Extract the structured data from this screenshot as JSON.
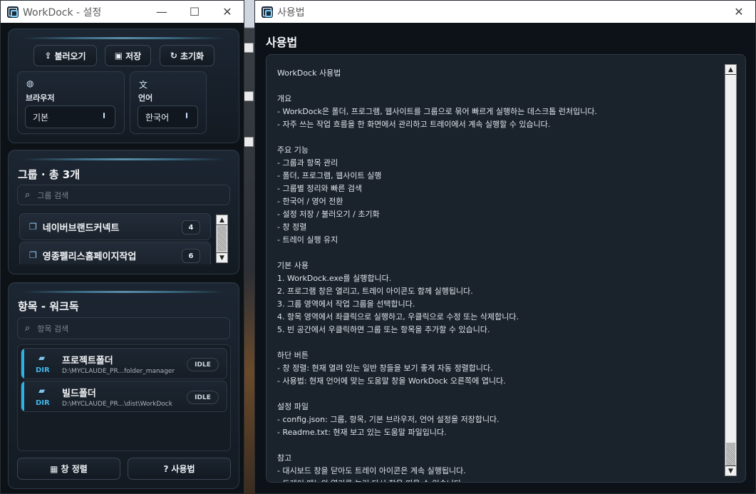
{
  "settings_window": {
    "title": "WorkDock - 설정",
    "controls": {
      "minimize": "—",
      "maximize": "☐",
      "close": "✕"
    },
    "toolbar": {
      "load_label": "불러오기",
      "save_label": "저장",
      "reset_label": "초기화"
    },
    "browser": {
      "label": "브라우저",
      "value": "기본"
    },
    "language": {
      "label": "언어",
      "value": "한국어"
    },
    "groups": {
      "title": "그룹 · 총 3개",
      "search_placeholder": "그룹 검색",
      "items": [
        {
          "name": "네이버브랜드커넥트",
          "count": "4"
        },
        {
          "name": "영종펠리스홈페이지작업",
          "count": "6"
        }
      ]
    },
    "items": {
      "title": "항목 - 워크독",
      "search_placeholder": "항목 검색",
      "list": [
        {
          "name": "프로젝트폴더",
          "type": "DIR",
          "path": "D:\\MYCLAUDE_PR...folder_manager",
          "status": "IDLE"
        },
        {
          "name": "빌드폴더",
          "type": "DIR",
          "path": "D:\\MYCLAUDE_PR...\\dist\\WorkDock",
          "status": "IDLE"
        }
      ]
    },
    "footer": {
      "arrange_label": "창 정렬",
      "help_label": "사용법"
    }
  },
  "help_window": {
    "title": "사용법",
    "controls": {
      "close": "✕"
    },
    "heading": "사용법",
    "lines": [
      "WorkDock 사용법",
      "",
      "개요",
      "- WorkDock은 폴더, 프로그램, 웹사이트를 그룹으로 묶어 빠르게 실행하는 데스크톱 런처입니다.",
      "- 자주 쓰는 작업 흐름을 한 화면에서 관리하고 트레이에서 계속 실행할 수 있습니다.",
      "",
      "주요 기능",
      "- 그룹과 항목 관리",
      "- 폴더, 프로그램, 웹사이트 실행",
      "- 그룹별 정리와 빠른 검색",
      "- 한국어 / 영어 전환",
      "- 설정 저장 / 불러오기 / 초기화",
      "- 창 정렬",
      "- 트레이 실행 유지",
      "",
      "기본 사용",
      "1. WorkDock.exe를 실행합니다.",
      "2. 프로그램 창은 열리고, 트레이 아이콘도 함께 실행됩니다.",
      "3. 그룹 영역에서 작업 그룹을 선택합니다.",
      "4. 항목 영역에서 좌클릭으로 실행하고, 우클릭으로 수정 또는 삭제합니다.",
      "5. 빈 공간에서 우클릭하면 그룹 또는 항목을 추가할 수 있습니다.",
      "",
      "하단 버튼",
      "- 창 정렬: 현재 열려 있는 일반 창들을 보기 좋게 자동 정렬합니다.",
      "- 사용법: 현재 언어에 맞는 도움말 창을 WorkDock 오른쪽에 엽니다.",
      "",
      "설정 파일",
      "- config.json: 그룹, 항목, 기본 브라우저, 언어 설정을 저장합니다.",
      "- Readme.txt: 현재 보고 있는 도움말 파일입니다.",
      "",
      "참고",
      "- 대시보드 창을 닫아도 트레이 아이콘은 계속 실행됩니다.",
      "- 트레이 메뉴의 열기를 눌러 다시 창을 띄울 수 있습니다."
    ]
  },
  "colors": {
    "accent": "#2bb3e6",
    "panel_bg": "#1c2632",
    "window_bg": "#0d1217"
  }
}
